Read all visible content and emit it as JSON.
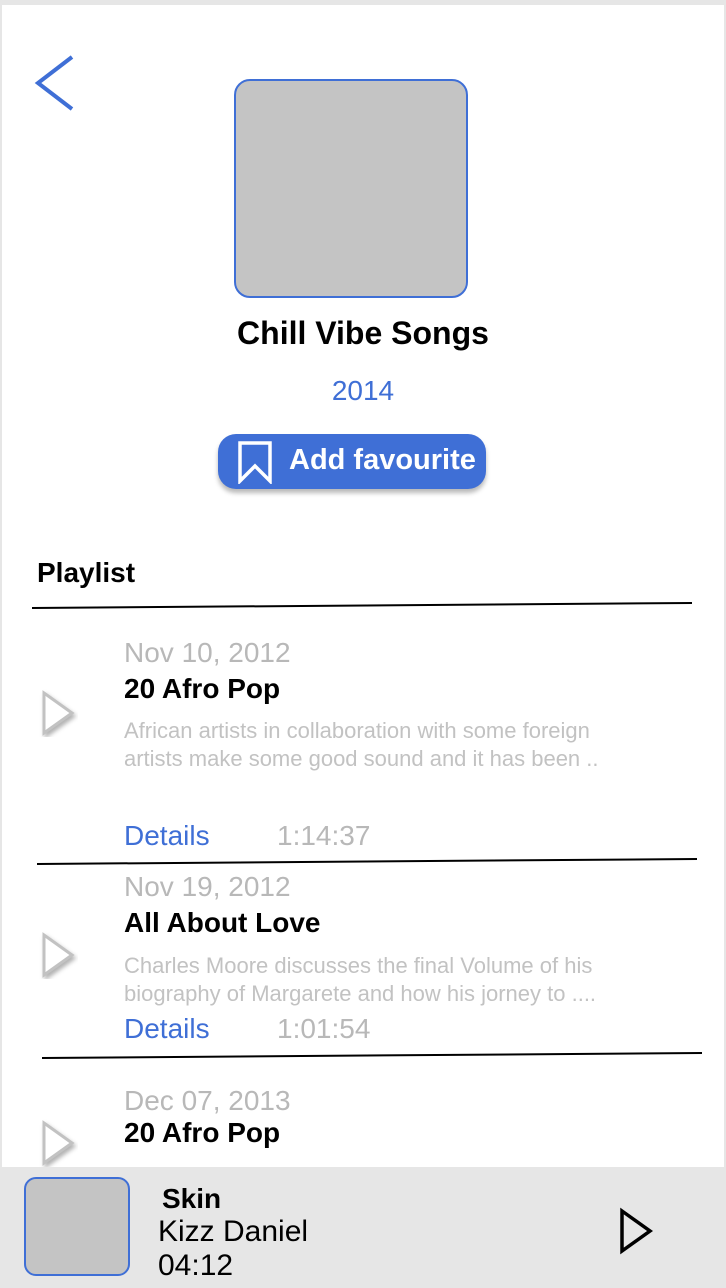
{
  "header": {
    "back_icon": "chevron-left-icon",
    "album_title": "Chill Vibe Songs",
    "album_year": "2014",
    "favourite_button": {
      "icon": "bookmark-icon",
      "label": "Add favourite"
    }
  },
  "playlist": {
    "heading": "Playlist",
    "items": [
      {
        "date": "Nov 10, 2012",
        "title": "20 Afro Pop",
        "description_lines": [
          "African artists in collaboration with some foreign",
          "artists make some good sound and it has been .."
        ],
        "details_label": "Details",
        "duration": "1:14:37"
      },
      {
        "date": "Nov 19, 2012",
        "title": "All About Love",
        "description_lines": [
          "Charles Moore discusses the final Volume of his",
          "biography of Margarete and how his jorney to ...."
        ],
        "details_label": "Details",
        "duration": "1:01:54"
      },
      {
        "date": "Dec 07, 2013",
        "title": "20 Afro Pop"
      }
    ]
  },
  "now_playing": {
    "title": "Skin",
    "artist": "Kizz Daniel",
    "time": "04:12",
    "play_icon": "play-icon"
  },
  "colors": {
    "accent": "#3f6fd6",
    "muted_text": "#b8b8b8",
    "placeholder": "#c4c4c4",
    "player_bar": "#e6e6e6"
  }
}
